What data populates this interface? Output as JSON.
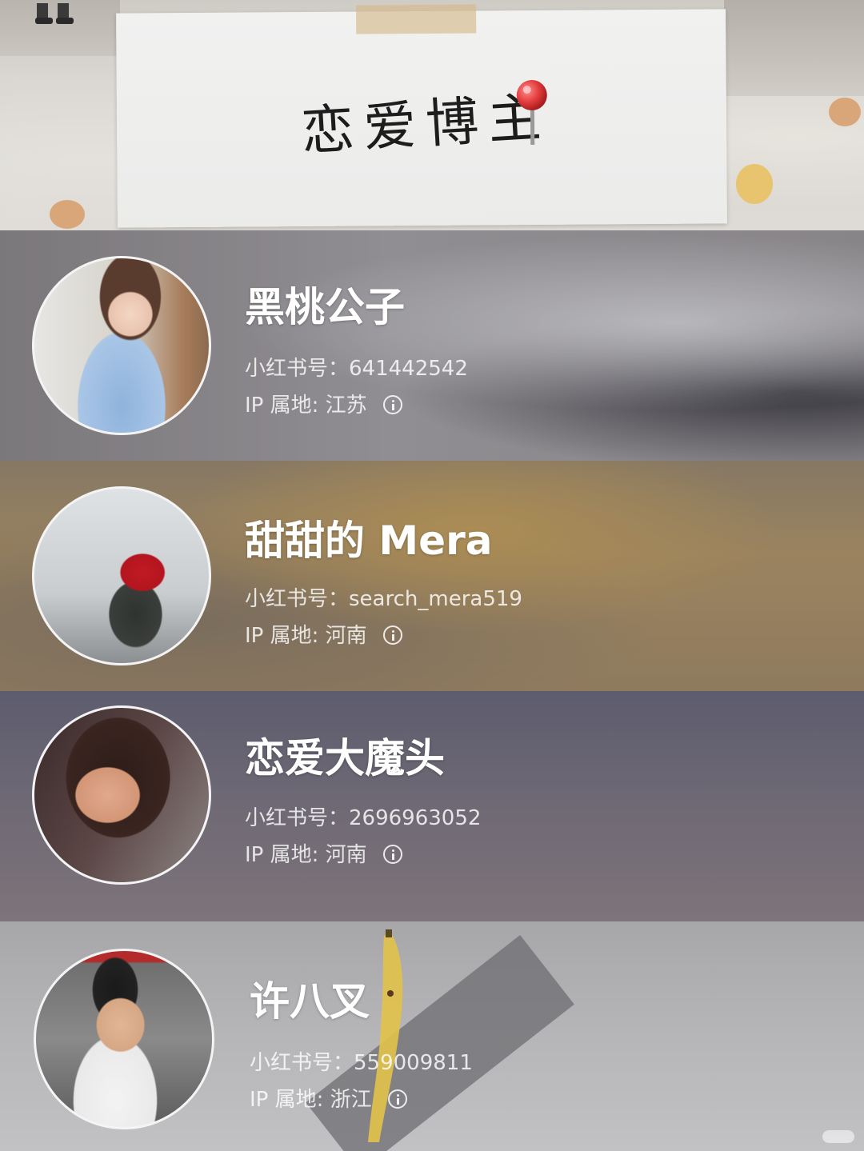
{
  "header": {
    "title": "恋爱博主"
  },
  "profiles": [
    {
      "name": "黑桃公子",
      "id_label": "小红书号：",
      "id_value": "641442542",
      "ip_label": "IP 属地: ",
      "ip_value": "江苏"
    },
    {
      "name": "甜甜的 Mera",
      "id_label": "小红书号：",
      "id_value": "search_mera519",
      "ip_label": "IP 属地: ",
      "ip_value": "河南"
    },
    {
      "name": "恋爱大魔头",
      "id_label": "小红书号：",
      "id_value": "2696963052",
      "ip_label": "IP 属地: ",
      "ip_value": "河南"
    },
    {
      "name": "许八叉",
      "id_label": "小红书号：",
      "id_value": "559009811",
      "ip_label": "IP 属地: ",
      "ip_value": "浙江"
    }
  ],
  "icons": {
    "pin": "pushpin-icon",
    "info": "info-icon"
  },
  "colors": {
    "pin_red": "#e23b3b",
    "text_white": "#ffffff"
  }
}
